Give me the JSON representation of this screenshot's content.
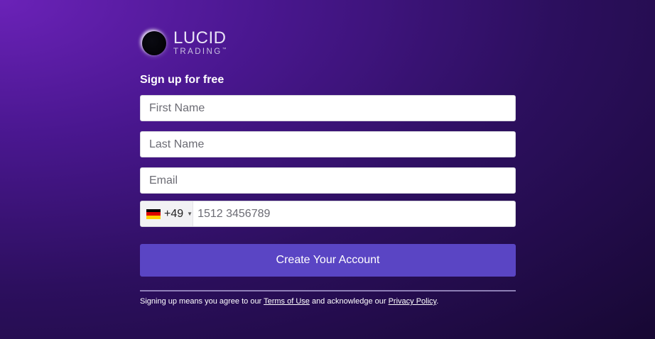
{
  "logo": {
    "name": "LUCID",
    "sub": "TRADING",
    "mark": "™"
  },
  "form": {
    "heading": "Sign up for free",
    "first_name_placeholder": "First Name",
    "last_name_placeholder": "Last Name",
    "email_placeholder": "Email",
    "phone": {
      "country_icon": "germany-flag-icon",
      "dial_code": "+49",
      "placeholder": "1512 3456789"
    },
    "submit_label": "Create Your Account"
  },
  "legal": {
    "prefix": "Signing up means you agree to our ",
    "terms_link": "Terms of Use",
    "middle": " and acknowledge our ",
    "privacy_link": "Privacy Policy",
    "suffix": "."
  },
  "colors": {
    "button": "#5a45c4",
    "flag_black": "#000000",
    "flag_red": "#dd0000",
    "flag_gold": "#ffce00"
  }
}
